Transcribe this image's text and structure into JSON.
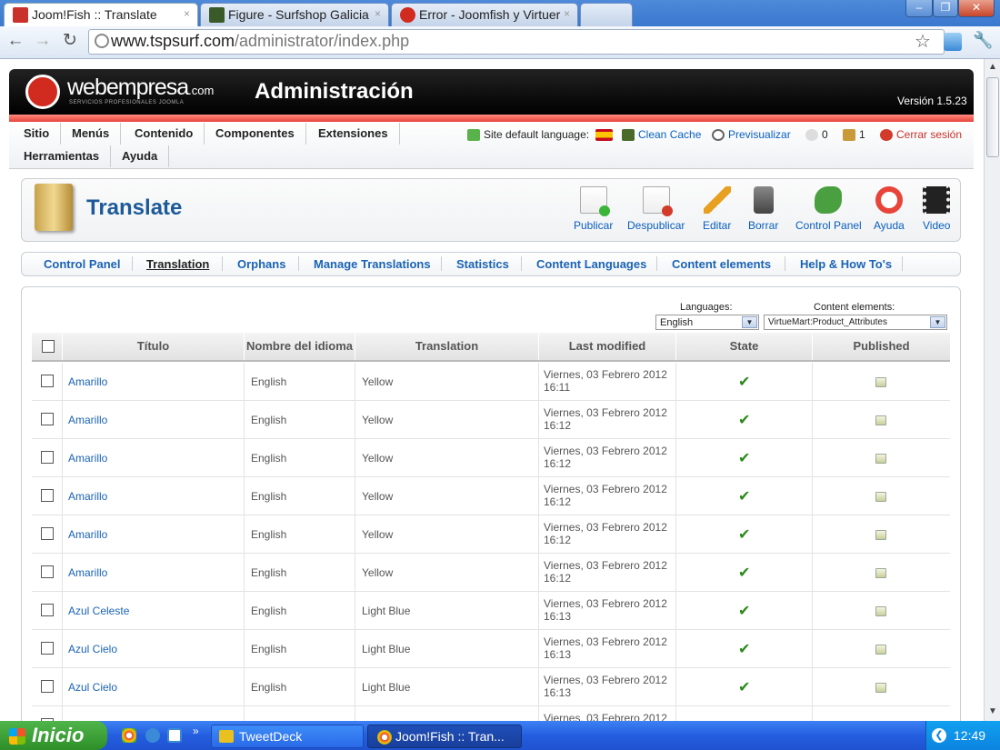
{
  "browser": {
    "tabs": [
      {
        "label": "Joom!Fish :: Translate",
        "active": true
      },
      {
        "label": "Figure - Surfshop Galicia",
        "active": false
      },
      {
        "label": "Error - Joomfish y Virtuer",
        "active": false
      }
    ],
    "close_glyph": "×",
    "url_host": "www.tspsurf.com",
    "url_path": "/administrator/index.php",
    "window_controls": {
      "minimize": "–",
      "restore": "❐",
      "close": "✕"
    }
  },
  "header": {
    "logo_main": "webempresa",
    "logo_suffix": ".com",
    "logo_tagline": "SERVICIOS PROFESIONALES JOOMLA",
    "title": "Administración",
    "version": "Versión 1.5.23"
  },
  "menu": {
    "items": [
      "Sitio",
      "Menús",
      "Contenido",
      "Componentes",
      "Extensiones",
      "Herramientas",
      "Ayuda"
    ],
    "site_language_label": "Site default language:",
    "clean_cache": "Clean Cache",
    "preview": "Previsualizar",
    "messages_count": "0",
    "users_count": "1",
    "logout": "Cerrar sesión"
  },
  "toolbar": {
    "title": "Translate",
    "buttons": [
      "Publicar",
      "Despublicar",
      "Editar",
      "Borrar",
      "Control Panel",
      "Ayuda",
      "Video"
    ]
  },
  "submenu": {
    "items": [
      "Control Panel",
      "Translation",
      "Orphans",
      "Manage Translations",
      "Statistics",
      "Content Languages",
      "Content elements",
      "Help & How To's"
    ],
    "current_index": 1
  },
  "filters": {
    "languages_label": "Languages:",
    "languages_value": "English",
    "content_elements_label": "Content elements:",
    "content_elements_value": "VirtueMart:Product_Attributes"
  },
  "table": {
    "headers": [
      "Título",
      "Nombre del idioma",
      "Translation",
      "Last modified",
      "State",
      "Published"
    ],
    "rows": [
      {
        "title": "Amarillo",
        "language": "English",
        "translation": "Yellow",
        "date": "Viernes, 03 Febrero 2012",
        "time": "16:11"
      },
      {
        "title": "Amarillo",
        "language": "English",
        "translation": "Yellow",
        "date": "Viernes, 03 Febrero 2012",
        "time": "16:12"
      },
      {
        "title": "Amarillo",
        "language": "English",
        "translation": "Yellow",
        "date": "Viernes, 03 Febrero 2012",
        "time": "16:12"
      },
      {
        "title": "Amarillo",
        "language": "English",
        "translation": "Yellow",
        "date": "Viernes, 03 Febrero 2012",
        "time": "16:12"
      },
      {
        "title": "Amarillo",
        "language": "English",
        "translation": "Yellow",
        "date": "Viernes, 03 Febrero 2012",
        "time": "16:12"
      },
      {
        "title": "Amarillo",
        "language": "English",
        "translation": "Yellow",
        "date": "Viernes, 03 Febrero 2012",
        "time": "16:12"
      },
      {
        "title": "Azul Celeste",
        "language": "English",
        "translation": "Light Blue",
        "date": "Viernes, 03 Febrero 2012",
        "time": "16:13"
      },
      {
        "title": "Azul Cielo",
        "language": "English",
        "translation": "Light Blue",
        "date": "Viernes, 03 Febrero 2012",
        "time": "16:13"
      },
      {
        "title": "Azul Cielo",
        "language": "English",
        "translation": "Light Blue",
        "date": "Viernes, 03 Febrero 2012",
        "time": "16:13"
      },
      {
        "title": "",
        "language": "",
        "translation": "",
        "date": "Viernes, 03 Febrero 2012",
        "time": ""
      }
    ],
    "state_glyph": "✔"
  },
  "taskbar": {
    "start_label": "Inicio",
    "tasks": [
      "TweetDeck",
      "Joom!Fish :: Tran..."
    ],
    "clock": "12:49"
  },
  "colors": {
    "accent_blue": "#1c5a99",
    "link_blue": "#1a63b5",
    "header_red": "#e8443a",
    "check_green": "#2a8a1a"
  }
}
